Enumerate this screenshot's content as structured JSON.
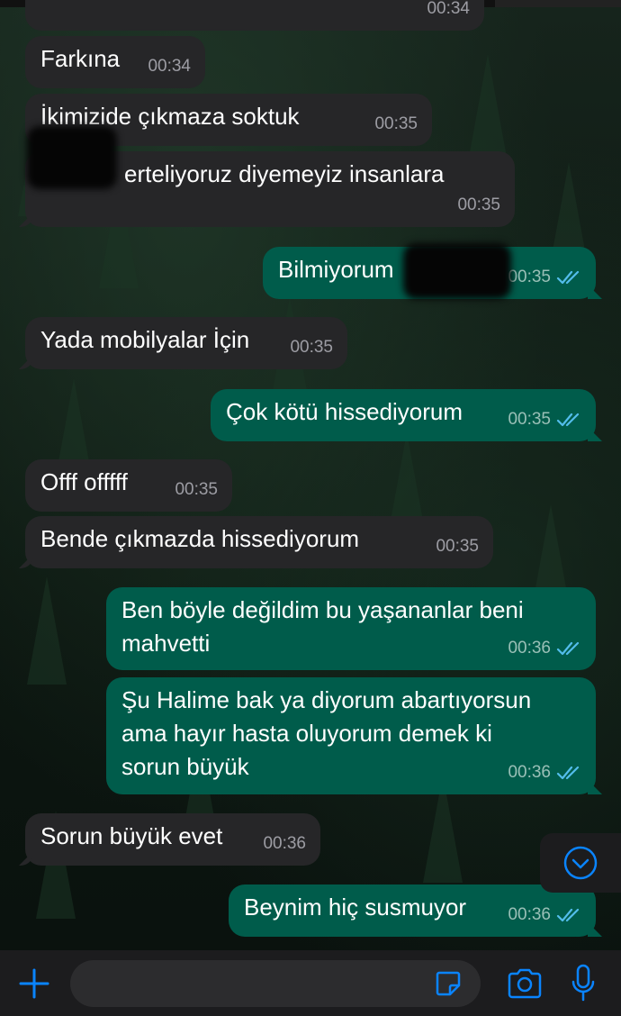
{
  "theme": {
    "incoming_bubble": "#262628",
    "outgoing_bubble": "#005c4b",
    "read_tick_color": "#53bdeb",
    "accent": "#0a84ff"
  },
  "messages": [
    {
      "direction": "in",
      "text": "",
      "time": "00:34",
      "note": "partially cut off at top"
    },
    {
      "direction": "in",
      "text": "Farkına",
      "time": "00:34"
    },
    {
      "direction": "in",
      "text": "İkimizide çıkmaza soktuk",
      "time": "00:35"
    },
    {
      "direction": "in",
      "text": "erteliyoruz diyemeyiz insanlara",
      "time": "00:35"
    },
    {
      "direction": "out",
      "text": "Bilmiyorum",
      "time": "00:35",
      "status": "read"
    },
    {
      "direction": "in",
      "text": "Yada mobilyalar İçin",
      "time": "00:35"
    },
    {
      "direction": "out",
      "text": "Çok kötü hissediyorum",
      "time": "00:35",
      "status": "read"
    },
    {
      "direction": "in",
      "text": "Offf offfff",
      "time": "00:35"
    },
    {
      "direction": "in",
      "text": "Bende çıkmazda hissediyorum",
      "time": "00:35"
    },
    {
      "direction": "out",
      "text": "Ben böyle değildim bu yaşananlar beni\nmahvetti",
      "time": "00:36",
      "status": "read"
    },
    {
      "direction": "out",
      "text": "Şu Halime bak ya diyorum abartıyorsun\nama hayır hasta oluyorum demek ki\nsorun büyük",
      "time": "00:36",
      "status": "read"
    },
    {
      "direction": "in",
      "text": "Sorun büyük evet",
      "time": "00:36"
    },
    {
      "direction": "out",
      "text": "Beynim hiç susmuyor",
      "time": "00:36",
      "status": "read"
    }
  ],
  "input_bar": {
    "placeholder": "",
    "icons": [
      "plus-icon",
      "sticker-icon",
      "camera-icon",
      "microphone-icon"
    ]
  },
  "scroll_down_icon": "chevron-down-circle-icon"
}
